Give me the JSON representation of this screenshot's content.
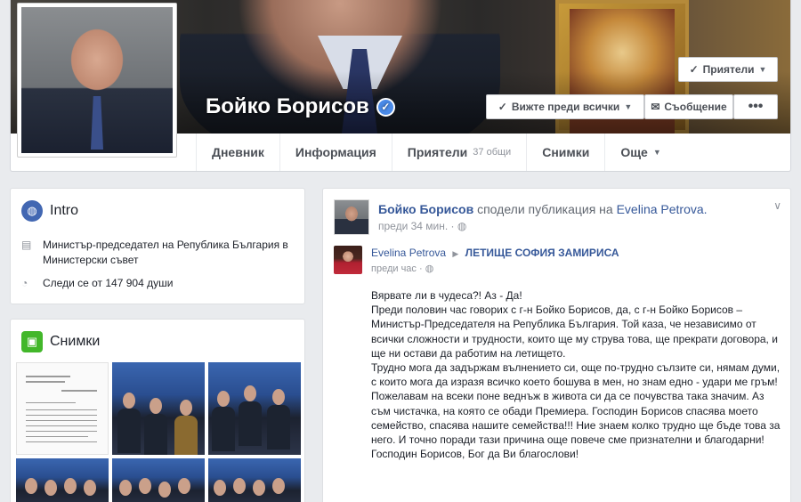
{
  "profile": {
    "name": "Бойко Борисов",
    "verified": true
  },
  "actions": {
    "friends": "Приятели",
    "follow": "Вижте преди всички",
    "message": "Съобщение",
    "more": "•••"
  },
  "nav": {
    "items": [
      {
        "label": "Дневник",
        "active": true
      },
      {
        "label": "Информация"
      },
      {
        "label": "Приятели",
        "count": "37 общи"
      },
      {
        "label": "Снимки"
      },
      {
        "label": "Още"
      }
    ]
  },
  "intro": {
    "title": "Intro",
    "job": "Министър-председател на Република България в Министерски съвет",
    "followers": "Следи се от 147 904 души"
  },
  "photos": {
    "title": "Снимки"
  },
  "post": {
    "author": "Бойко Борисов",
    "action": "сподели публикация",
    "preposition": "на",
    "source": "Evelina Petrova.",
    "time": "преди 34 мин.",
    "shared": {
      "author": "Evelina Petrova",
      "group": "ЛЕТИЩЕ СОФИЯ ЗАМИРИСА",
      "time": "преди час"
    },
    "body": [
      "Вярвате ли в чудеса?! Аз - Да!",
      "Преди половин час говорих с г-н Бойко Борисов, да, с г-н Бойко Борисов – Министър-Председателя на Република България. Той каза, че независимо от всички сложности и трудности, които ще му струва това, ще прекрати договора, и ще ни остави да работим на летището.",
      "Трудно мога да задържам вълнението си, още по-трудно сълзите си, нямам думи, с които мога да изразя всичко което бошува в мен, но знам едно - удари ме гръм! Пожелавам на всеки поне веднъж в живота си да се почувства така значим. Аз съм чистачка, на която се обади Премиера. Господин Борисов спасява моето семейство, спасява нашите семейства!!! Ние знаем колко трудно ще бъде това за него. И точно поради тази причина още повече сме признателни и благодарни!",
      "Господин Борисов, Бог да Ви благослови!"
    ]
  }
}
